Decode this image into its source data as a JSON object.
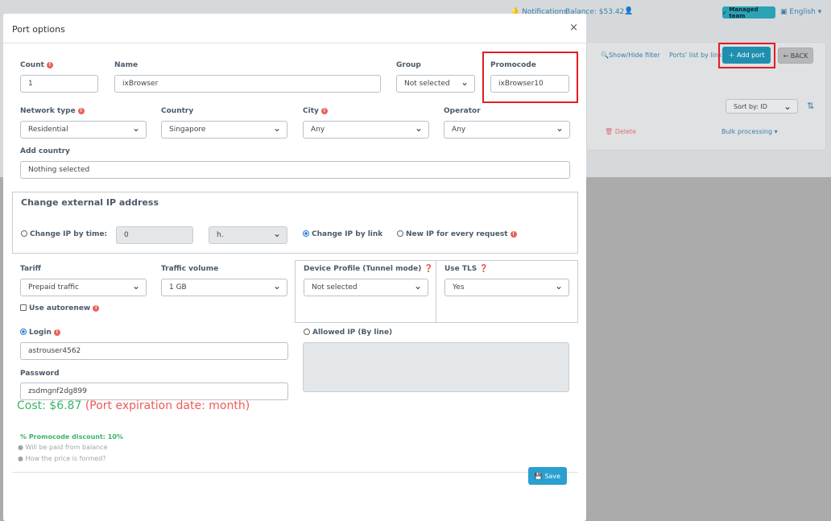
{
  "topbar": {
    "notifications": "Notifications",
    "balance": "Balance: $53.42",
    "managed_team": "Managed team",
    "language": "English"
  },
  "page": {
    "show_hide_filter": "Show/Hide filter",
    "ports_list_by_link": "Ports' list by link",
    "add_port": "Add port",
    "back": "← BACK",
    "sort_by": "Sort by: ID",
    "delete": "Delete",
    "bulk_processing": "Bulk processing"
  },
  "modal": {
    "title": "Port options",
    "count": {
      "label": "Count",
      "value": "1"
    },
    "name": {
      "label": "Name",
      "value": "ixBrowser"
    },
    "group": {
      "label": "Group",
      "value": "Not selected"
    },
    "promocode": {
      "label": "Promocode",
      "value": "ixBrowser10"
    },
    "network_type": {
      "label": "Network type",
      "value": "Residential"
    },
    "country": {
      "label": "Country",
      "value": "Singapore"
    },
    "city": {
      "label": "City",
      "value": "Any"
    },
    "operator": {
      "label": "Operator",
      "value": "Any"
    },
    "add_country": {
      "label": "Add country",
      "value": "Nothing selected"
    },
    "change_ip": {
      "title": "Change external IP address",
      "by_time": "Change IP by time:",
      "time_value": "0",
      "time_unit": "h.",
      "by_link": "Change IP by link",
      "new_ip": "New IP for every request",
      "selected": "by_link"
    },
    "tariff": {
      "label": "Tariff",
      "value": "Prepaid traffic"
    },
    "traffic_volume": {
      "label": "Traffic volume",
      "value": "1 GB"
    },
    "device_profile": {
      "label": "Device Profile (Tunnel mode)",
      "value": "Not selected"
    },
    "use_tls": {
      "label": "Use TLS",
      "value": "Yes"
    },
    "autorenew": {
      "label": "Use autorenew",
      "checked": false
    },
    "login": {
      "label": "Login",
      "value": "astrouser4562",
      "selected": true
    },
    "password": {
      "label": "Password",
      "value": "zsdmgnf2dg899"
    },
    "allowed_ip": {
      "label": "Allowed IP (By line)",
      "value": ""
    },
    "cost": "Cost: $6.87",
    "expiration": "(Port expiration date: month)",
    "discount": "Promocode discount: 10%",
    "paid_from_balance": "Will be paid from balance",
    "price_formed": "How the price is formed?",
    "save": "Save"
  },
  "colors": {
    "accent": "#1f8fb0",
    "cost": "#3bb468",
    "warning": "#ee5a5a",
    "highlight": "#e41c23"
  }
}
